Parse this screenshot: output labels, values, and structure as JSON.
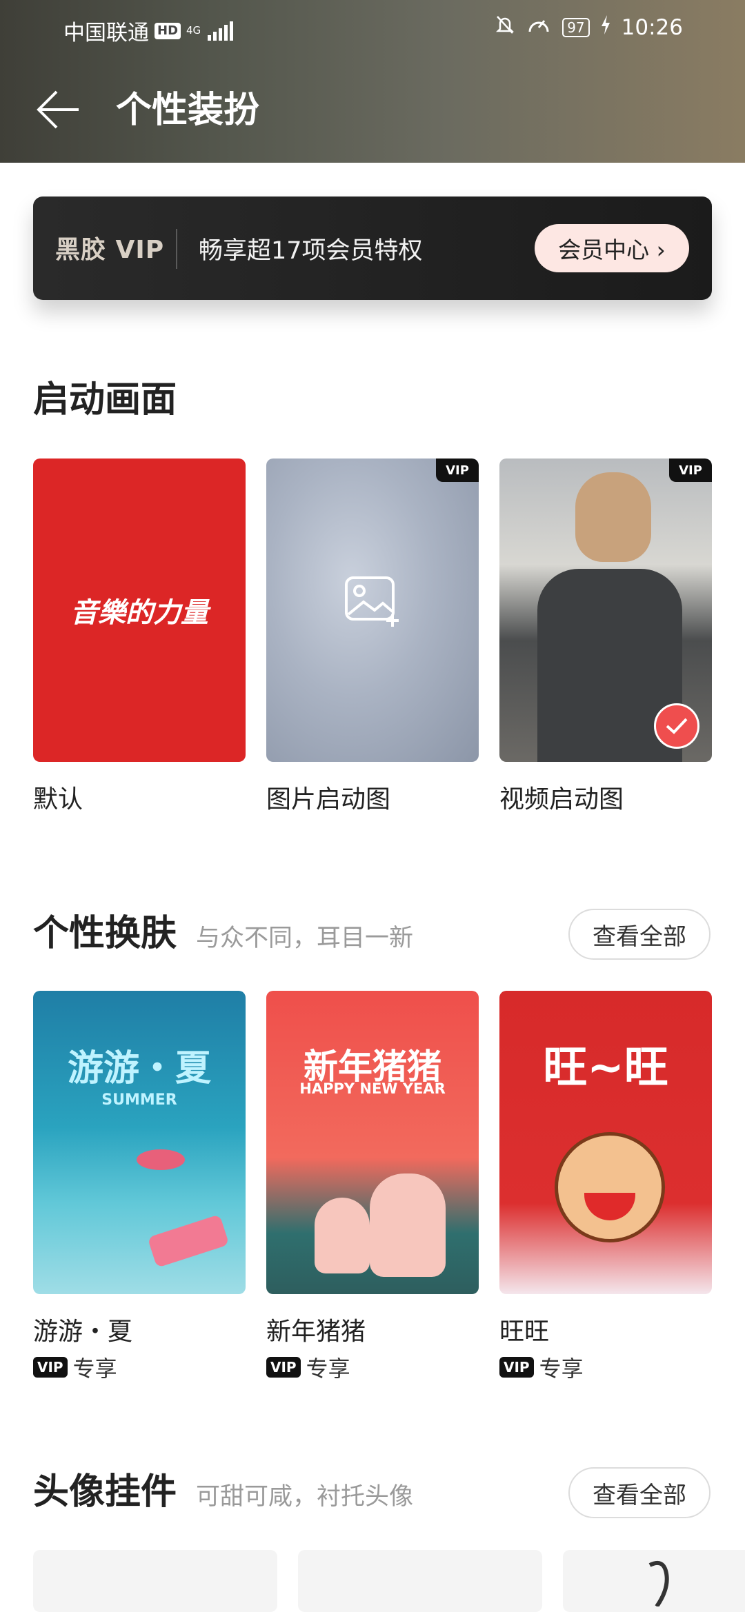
{
  "status_bar": {
    "carrier": "中国联通",
    "hd_badge": "HD",
    "network": "4G",
    "battery": "97",
    "time": "10:26"
  },
  "nav": {
    "title": "个性装扮"
  },
  "vip_banner": {
    "logo_text": "黑胶 VIP",
    "text": "畅享超17项会员特权",
    "button_label": "会员中心 ›"
  },
  "splash_section": {
    "title": "启动画面",
    "items": [
      {
        "label": "默认",
        "thumb_text": "音樂的力量"
      },
      {
        "label": "图片启动图",
        "vip_corner": "VIP"
      },
      {
        "label": "视频启动图",
        "vip_corner": "VIP"
      }
    ]
  },
  "skin_section": {
    "title": "个性换肤",
    "subtitle": "与众不同，耳目一新",
    "view_all": "查看全部",
    "items": [
      {
        "label": "游游・夏",
        "thumb_title": "游游・夏",
        "thumb_sub": "SUMMER",
        "vip_tag": "VIP",
        "exclusive": "专享"
      },
      {
        "label": "新年猪猪",
        "thumb_title": "新年猪猪",
        "thumb_sub": "HAPPY NEW YEAR",
        "vip_tag": "VIP",
        "exclusive": "专享"
      },
      {
        "label": "旺旺",
        "thumb_title": "旺~旺",
        "vip_tag": "VIP",
        "exclusive": "专享"
      }
    ]
  },
  "avatar_section": {
    "title": "头像挂件",
    "subtitle": "可甜可咸，衬托头像",
    "view_all": "查看全部"
  }
}
